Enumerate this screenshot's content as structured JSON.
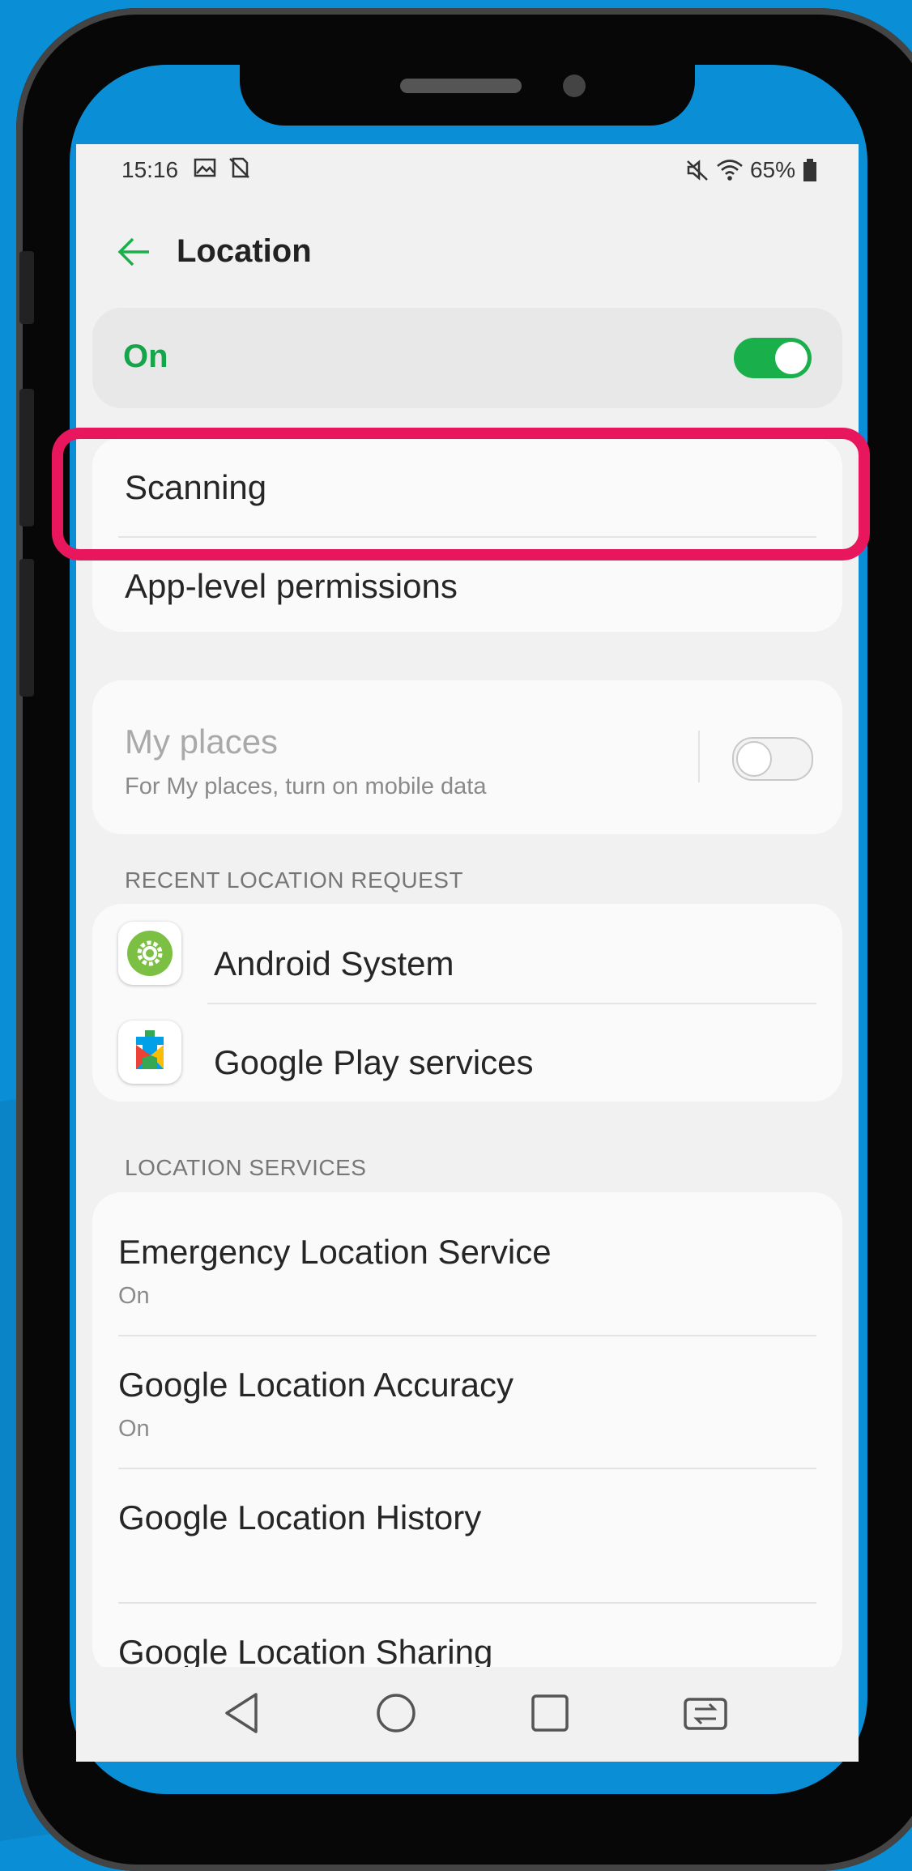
{
  "status_bar": {
    "time": "15:16",
    "battery": "65%"
  },
  "header": {
    "title": "Location"
  },
  "master_switch": {
    "label": "On",
    "state": "on"
  },
  "menu": {
    "scanning": "Scanning",
    "app_permissions": "App-level permissions"
  },
  "my_places": {
    "title": "My places",
    "subtitle": "For My places, turn on mobile data",
    "state": "off"
  },
  "recent_requests": {
    "header": "RECENT LOCATION REQUEST",
    "items": [
      {
        "label": "Android System",
        "icon": "android-system-gear-icon"
      },
      {
        "label": "Google Play services",
        "icon": "google-play-services-icon"
      }
    ]
  },
  "location_services": {
    "header": "LOCATION SERVICES",
    "items": [
      {
        "label": "Emergency Location Service",
        "sub": "On"
      },
      {
        "label": "Google Location Accuracy",
        "sub": "On"
      },
      {
        "label": "Google Location History"
      },
      {
        "label": "Google Location Sharing"
      }
    ]
  },
  "colors": {
    "accent_green": "#19b04b",
    "highlight": "#e8175d",
    "background_blue": "#0a8fd6"
  }
}
